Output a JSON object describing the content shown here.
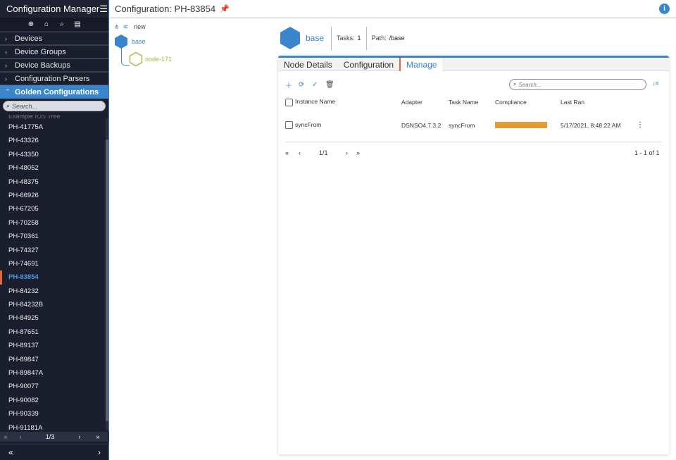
{
  "app": {
    "title": "Configuration Manager",
    "menu_icon": "hamburger-icon",
    "logo_icon": "cube-icon"
  },
  "toolbar_icons": [
    "add-circle-icon",
    "home-icon",
    "search-icon",
    "document-icon"
  ],
  "sidebar": {
    "categories": [
      {
        "label": "Devices",
        "expanded": false
      },
      {
        "label": "Device Groups",
        "expanded": false
      },
      {
        "label": "Device Backups",
        "expanded": false
      },
      {
        "label": "Configuration Parsers",
        "expanded": false
      },
      {
        "label": "Golden Configurations",
        "expanded": true
      }
    ],
    "search_placeholder": "Search...",
    "partial_item": "Example IOS Tree",
    "items": [
      "PH-41775A",
      "PH-43326",
      "PH-43350",
      "PH-48052",
      "PH-48375",
      "PH-66926",
      "PH-67205",
      "PH-70258",
      "PH-70361",
      "PH-74327",
      "PH-74691",
      "PH-83854",
      "PH-84232",
      "PH-84232B",
      "PH-84925",
      "PH-87651",
      "PH-89137",
      "PH-89847",
      "PH-89847A",
      "PH-90077",
      "PH-90082",
      "PH-90339",
      "PH-91181A"
    ],
    "selected": "PH-83854",
    "pager": {
      "page": "1/3"
    }
  },
  "header": {
    "title": "Configuration: PH-83854"
  },
  "tree": {
    "new_label": "new",
    "root": {
      "label": "base",
      "color": "#3a86cc"
    },
    "child": {
      "label": "node-171",
      "color": "#a7b43b"
    }
  },
  "node": {
    "name": "base",
    "tasks_label": "Tasks:",
    "tasks_value": "1",
    "path_label": "Path:",
    "path_value": "/base"
  },
  "tabs": [
    {
      "label": "Node Details",
      "active": false
    },
    {
      "label": "Configuration",
      "active": false
    },
    {
      "label": "Manage",
      "active": true
    }
  ],
  "manage": {
    "search_placeholder": "Search...",
    "columns": [
      "Instance Name",
      "Adapter",
      "Task Name",
      "Compliance",
      "Last Ran"
    ],
    "rows": [
      {
        "instance": "syncFrom",
        "adapter": "DSNSO4.7.3.2",
        "task": "syncFrom",
        "compliance": 1.0,
        "compliance_color": "#e79b34",
        "last_ran": "5/17/2021, 8:48:22 AM"
      }
    ],
    "pager": {
      "page": "1/1",
      "range": "1 - 1 of 1"
    }
  },
  "colors": {
    "accent": "#3a86cc",
    "sidebar_bg": "#1b1f2d",
    "selection_marker": "#e2673b"
  }
}
